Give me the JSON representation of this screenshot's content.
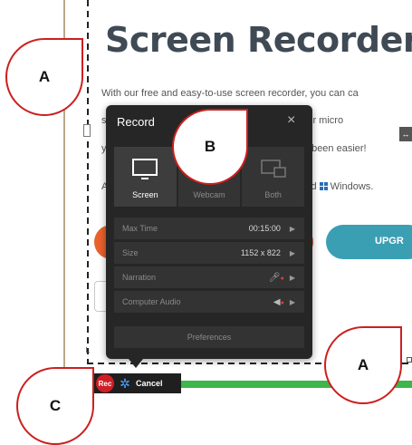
{
  "page": {
    "title": "Screen Recorder",
    "line1": "With our free and easy-to-use screen recorder, you can ca",
    "line2": "s",
    "line2b": "n from your micro",
    "line3": "y",
    "line3b": "never been easier!",
    "line4": "A",
    "line4b": "nd",
    "line4c": "Windows.",
    "upgrade_label": "UPGR"
  },
  "panel": {
    "title": "Record",
    "close_glyph": "×",
    "modes": [
      {
        "label": "Screen",
        "icon": "monitor-icon",
        "active": true
      },
      {
        "label": "Webcam",
        "icon": "webcam-icon",
        "active": false
      },
      {
        "label": "Both",
        "icon": "both-icon",
        "active": false
      }
    ],
    "rows": [
      {
        "label": "Max Time",
        "value": "00:15:00"
      },
      {
        "label": "Size",
        "value": "1152 x 822"
      },
      {
        "label": "Narration",
        "value": ""
      },
      {
        "label": "Computer Audio",
        "value": ""
      }
    ],
    "preferences_label": "Preferences"
  },
  "toolbar": {
    "rec_label": "Rec",
    "cancel_label": "Cancel"
  },
  "callouts": {
    "a_top": "A",
    "b": "B",
    "a_bottom": "A",
    "c": "C"
  },
  "colors": {
    "callout_border": "#cc1f1f",
    "rec_red": "#cf1f25",
    "progress_green": "#3db64a",
    "upgrade_teal": "#3b9fb4",
    "orange": "#e8612c",
    "panel_bg": "#262626"
  }
}
